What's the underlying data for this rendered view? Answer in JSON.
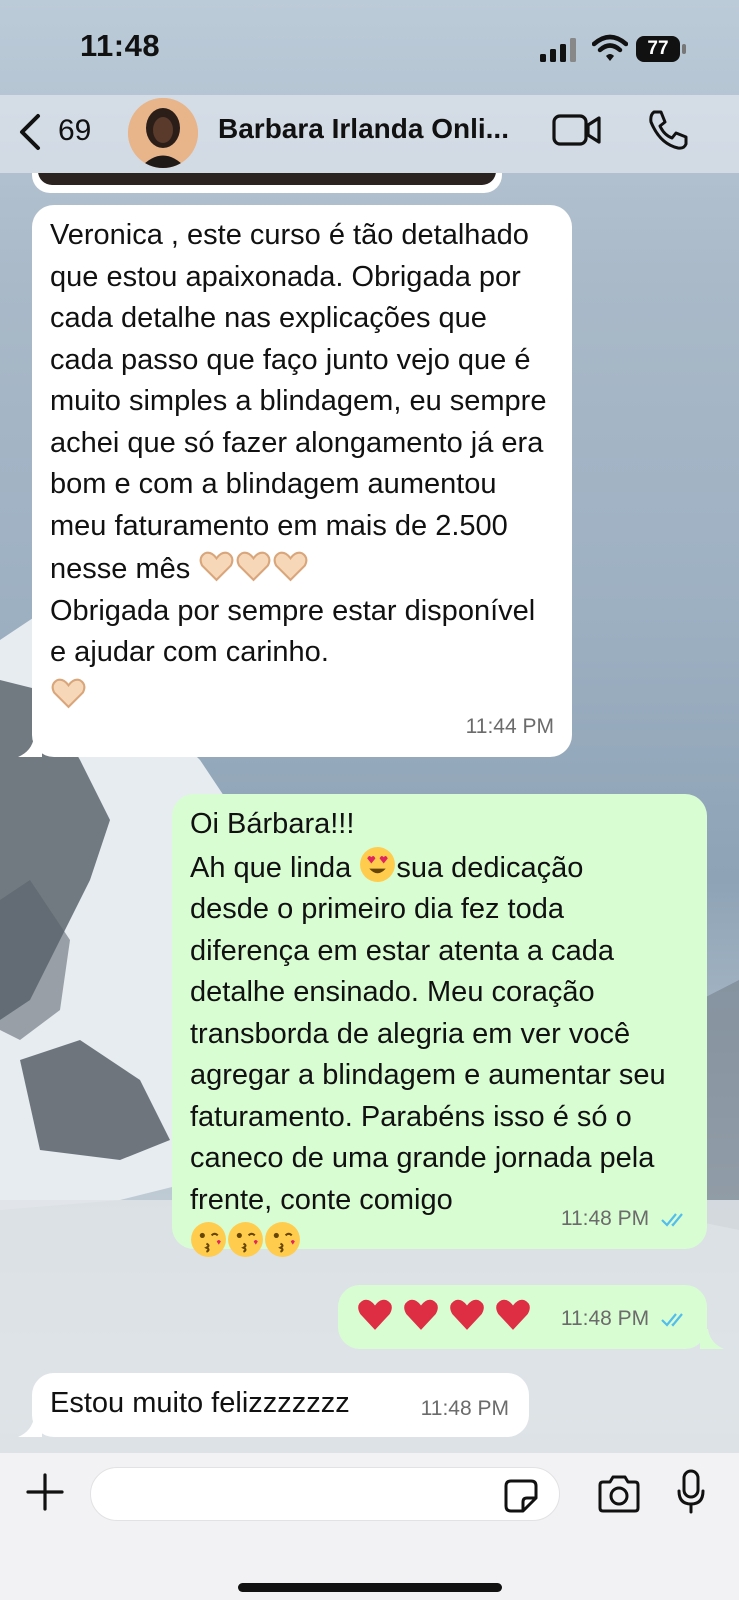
{
  "status_bar": {
    "time": "11:48",
    "battery": "77"
  },
  "header": {
    "back_count": "69",
    "contact_name": "Barbara Irlanda Onli..."
  },
  "messages": [
    {
      "direction": "incoming",
      "text": "Veronica , este curso é tão detalhado que estou apaixonada. Obrigada por cada detalhe nas explicações que cada passo que faço junto vejo que é muito simples a blindagem, eu sempre achei que só fazer alongamento já era bom e com a blindagem aumentou meu faturamento em mais de 2.500 nesse mês",
      "text_after": "Obrigada por sempre estar disponível e ajudar com carinho.",
      "time": "11:44 PM"
    },
    {
      "direction": "outgoing",
      "line1": "Oi Bárbara!!!",
      "line2_start": "Ah que linda ",
      "line2_end": "sua dedicação",
      "text": "desde o primeiro dia fez toda diferença em estar atenta a cada detalhe ensinado. Meu coração transborda de alegria em ver você agregar a blindagem e aumentar seu faturamento. Parabéns isso é só o caneco de uma grande jornada pela frente, conte comigo",
      "time": "11:48 PM",
      "read": true
    },
    {
      "direction": "outgoing",
      "text": "",
      "emoji": "four red hearts",
      "time": "11:48 PM",
      "read": true
    },
    {
      "direction": "incoming",
      "text": "Estou muito felizzzzzzz",
      "time": "11:48 PM"
    }
  ],
  "input": {
    "value": "",
    "placeholder": ""
  },
  "colors": {
    "incoming_bubble": "#ffffff",
    "outgoing_bubble": "#d9fdd3",
    "read_ticks": "#53bdeb"
  },
  "icons": [
    "back-chevron-icon",
    "video-call-icon",
    "phone-call-icon",
    "plus-icon",
    "sticker-icon",
    "camera-icon",
    "microphone-icon"
  ]
}
